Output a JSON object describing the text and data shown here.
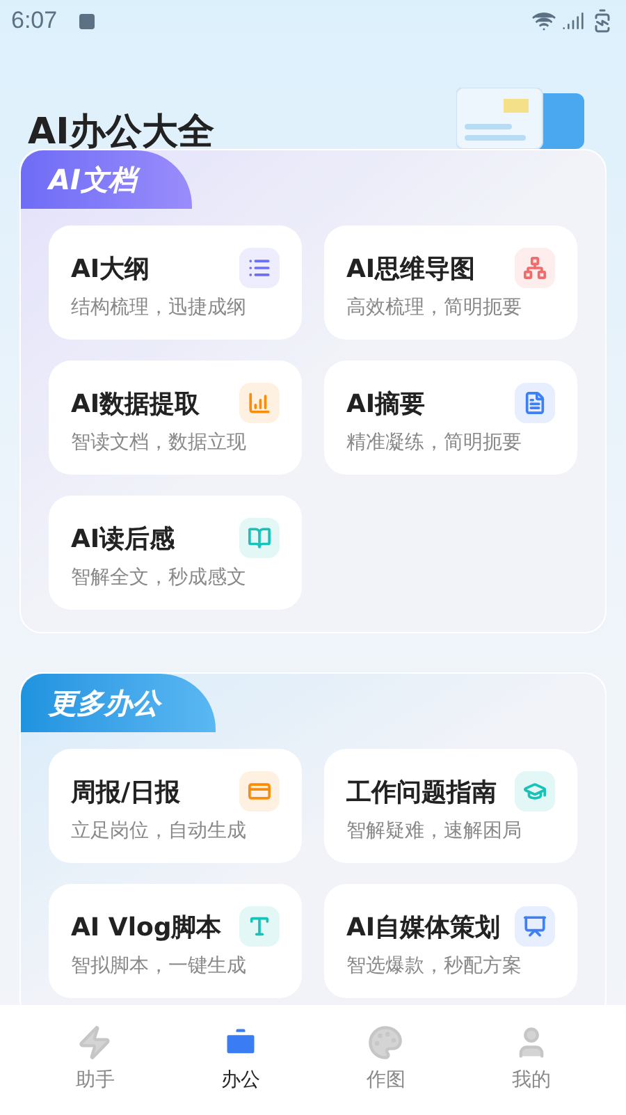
{
  "status_bar": {
    "time": "6:07"
  },
  "title": "AI办公大全",
  "sections": [
    {
      "title": "AI文档",
      "items": [
        {
          "title": "AI大纲",
          "subtitle": "结构梳理，迅捷成纲",
          "color": "#6b6ff5"
        },
        {
          "title": "AI思维导图",
          "subtitle": "高效梳理，简明扼要",
          "color": "#f26b6b"
        },
        {
          "title": "AI数据提取",
          "subtitle": "智读文档，数据立现",
          "color": "#fb8c0a"
        },
        {
          "title": "AI摘要",
          "subtitle": "精准凝练，简明扼要",
          "color": "#3d7ff5"
        },
        {
          "title": "AI读后感",
          "subtitle": "智解全文，秒成感文",
          "color": "#19c2b8"
        }
      ]
    },
    {
      "title": "更多办公",
      "items": [
        {
          "title": "周报/日报",
          "subtitle": "立足岗位，自动生成",
          "color": "#fb8c0a"
        },
        {
          "title": "工作问题指南",
          "subtitle": "智解疑难，速解困局",
          "color": "#19c2b8"
        },
        {
          "title": "AI Vlog脚本",
          "subtitle": "智拟脚本，一键生成",
          "color": "#19c2b8"
        },
        {
          "title": "AI自媒体策划",
          "subtitle": "智选爆款，秒配方案",
          "color": "#3d7ff5"
        }
      ]
    }
  ],
  "nav": [
    {
      "label": "助手",
      "selected": false
    },
    {
      "label": "办公",
      "selected": true
    },
    {
      "label": "作图",
      "selected": false
    },
    {
      "label": "我的",
      "selected": false
    }
  ]
}
